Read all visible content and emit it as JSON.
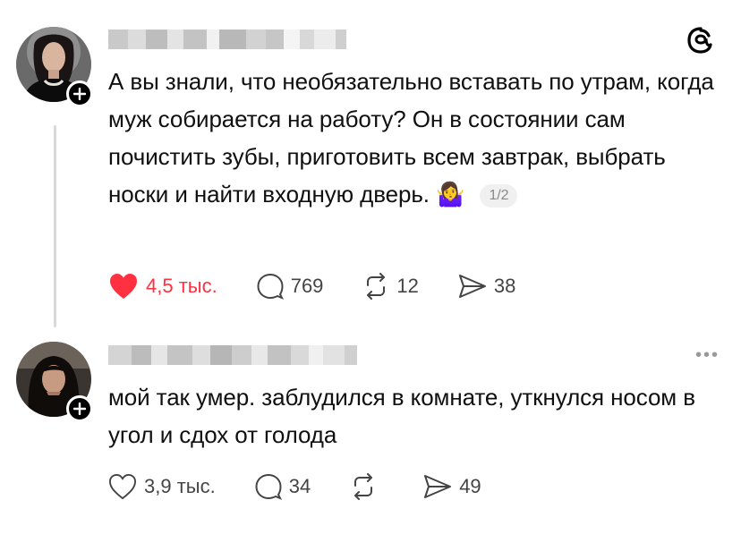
{
  "posts": [
    {
      "text": "А вы знали, что необязательно вставать по утрам, когда муж собирается на работу? Он в состоянии сам почистить зубы, приготовить всем завтрак, выбрать носки и найти входную дверь.",
      "emoji": "🤷‍♀️",
      "page_badge": "1/2",
      "likes": "4,5 тыс.",
      "liked": true,
      "comments": "769",
      "reposts": "12",
      "shares": "38"
    },
    {
      "text": "мой так умер. заблудился в комнате, уткнулся носом в угол и сдох от голода",
      "likes": "3,9 тыс.",
      "liked": false,
      "comments": "34",
      "reposts": "",
      "shares": "49"
    }
  ],
  "colors": {
    "liked": "#ff3040",
    "muted": "#444444",
    "line": "#d9d9d9"
  },
  "icons": [
    "threads-logo-icon",
    "heart-icon",
    "comment-icon",
    "repost-icon",
    "share-icon",
    "plus-icon",
    "more-icon"
  ]
}
